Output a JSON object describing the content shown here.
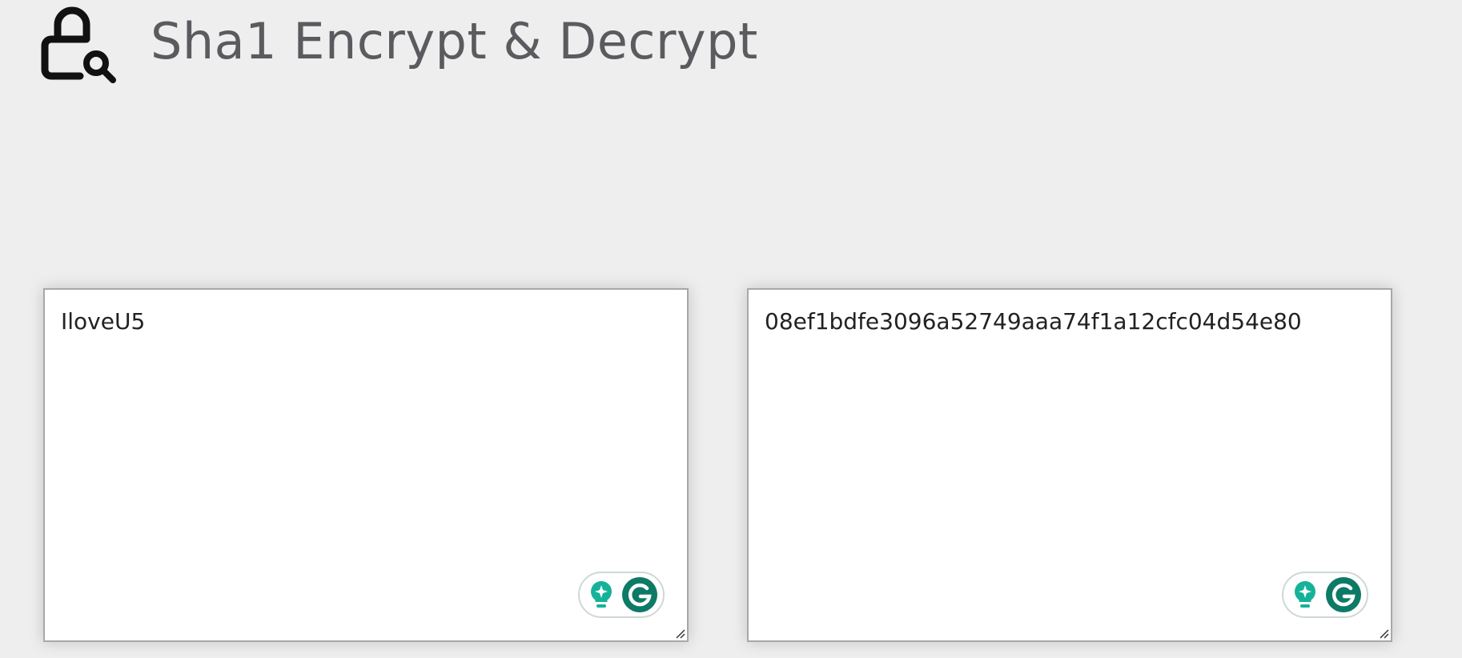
{
  "header": {
    "icon": "lock-search-icon",
    "title": "Sha1 Encrypt & Decrypt"
  },
  "input_panel": {
    "value": "IloveU5"
  },
  "output_panel": {
    "value": "08ef1bdfe3096a52749aaa74f1a12cfc04d54e80"
  },
  "grammarly_widget": {
    "icons": [
      "lightbulb-sparkle-icon",
      "grammarly-g-icon"
    ],
    "accent_bulb": "#15b29a",
    "accent_g": "#0d7a67"
  },
  "colors": {
    "background": "#eeeeee",
    "title_text": "#5b5b5f",
    "panel_border": "#a8a8a8"
  }
}
